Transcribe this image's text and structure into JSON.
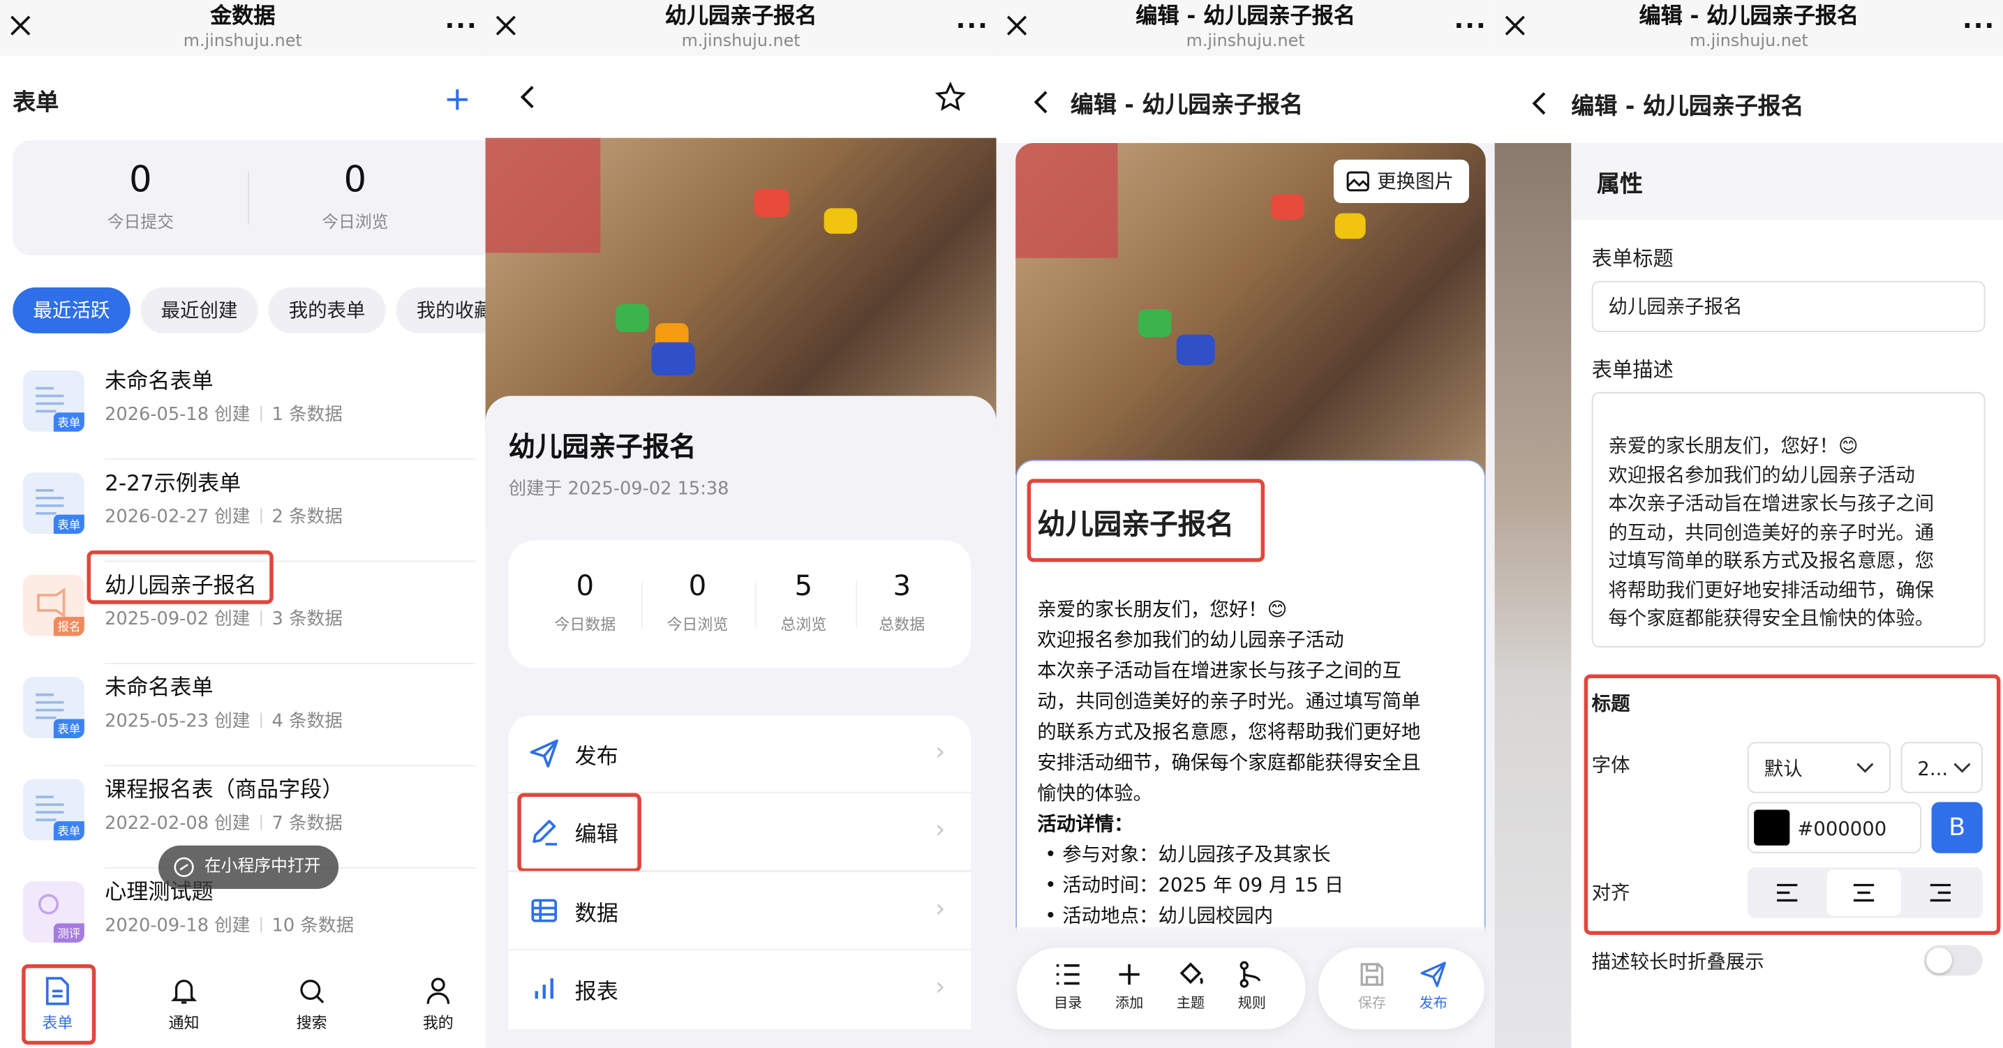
{
  "panel1": {
    "wx_title": "金数据",
    "wx_url": "m.jinshuju.net",
    "header_title": "表单",
    "stats": [
      {
        "value": "0",
        "label": "今日提交"
      },
      {
        "value": "0",
        "label": "今日浏览"
      }
    ],
    "chips": [
      "最近活跃",
      "最近创建",
      "我的表单",
      "我的收藏"
    ],
    "forms": [
      {
        "name": "未命名表单",
        "date": "2026-05-18 创建",
        "count": "1 条数据",
        "badge": "表单"
      },
      {
        "name": "2-27示例表单",
        "date": "2026-02-27 创建",
        "count": "2 条数据",
        "badge": "表单"
      },
      {
        "name": "幼儿园亲子报名",
        "date": "2025-09-02 创建",
        "count": "3 条数据",
        "badge": "报名"
      },
      {
        "name": "未命名表单",
        "date": "2025-05-23 创建",
        "count": "4 条数据",
        "badge": "表单"
      },
      {
        "name": "课程报名表（商品字段）",
        "date": "2022-02-08 创建",
        "count": "7 条数据",
        "badge": "表单"
      },
      {
        "name": "心理测试题",
        "date": "2020-09-18 创建",
        "count": "10 条数据",
        "badge": "测评"
      }
    ],
    "toast": "在小程序中打开",
    "tabs": [
      "表单",
      "通知",
      "搜索",
      "我的"
    ],
    "colors": {
      "accent": "#2f6fe9",
      "highlight": "#e0473c"
    }
  },
  "panel2": {
    "wx_title": "幼儿园亲子报名",
    "wx_url": "m.jinshuju.net",
    "form_title": "幼儿园亲子报名",
    "created": "创建于 2025-09-02 15:38",
    "stats": [
      {
        "value": "0",
        "label": "今日数据"
      },
      {
        "value": "0",
        "label": "今日浏览"
      },
      {
        "value": "5",
        "label": "总浏览"
      },
      {
        "value": "3",
        "label": "总数据"
      }
    ],
    "menu": [
      "发布",
      "编辑",
      "数据",
      "报表"
    ]
  },
  "panel3": {
    "wx_title": "编辑 - 幼儿园亲子报名",
    "wx_url": "m.jinshuju.net",
    "page_title": "编辑 - 幼儿园亲子报名",
    "change_image": "更换图片",
    "form_title": "幼儿园亲子报名",
    "desc_lines": [
      "亲爱的家长朋友们，您好！😊",
      "欢迎报名参加我们的幼儿园亲子活动",
      "本次亲子活动旨在增进家长与孩子之间的互",
      "动，共同创造美好的亲子时光。通过填写简单",
      "的联系方式及报名意愿，您将帮助我们更好地",
      "安排活动细节，确保每个家庭都能获得安全且",
      "愉快的体验。"
    ],
    "details_heading": "活动详情：",
    "details": [
      "参与对象：幼儿园孩子及其家长",
      "活动时间：2025 年 09 月 15 日",
      "活动地点：幼儿园校园内"
    ],
    "tools": [
      "目录",
      "添加",
      "主题",
      "规则"
    ],
    "actions": [
      "保存",
      "发布"
    ]
  },
  "panel4": {
    "wx_title": "编辑 - 幼儿园亲子报名",
    "wx_url": "m.jinshuju.net",
    "page_title": "编辑 - 幼儿园亲子报名",
    "section": "属性",
    "form_title_label": "表单标题",
    "form_title_value": "幼儿园亲子报名",
    "form_desc_label": "表单描述",
    "desc_lines": [
      "亲爱的家长朋友们，您好！😊",
      "欢迎报名参加我们的幼儿园亲子活动",
      "本次亲子活动旨在增进家长与孩子之间",
      "的互动，共同创造美好的亲子时光。通",
      "过填写简单的联系方式及报名意愿，您",
      "将帮助我们更好地安排活动细节，确保",
      "每个家庭都能获得安全且愉快的体验。"
    ],
    "title_section": "标题",
    "font_label": "字体",
    "font_value": "默认",
    "size_value": "2...",
    "color_value": "#000000",
    "bold_label": "B",
    "align_label": "对齐",
    "collapse_label": "描述较长时折叠展示"
  }
}
